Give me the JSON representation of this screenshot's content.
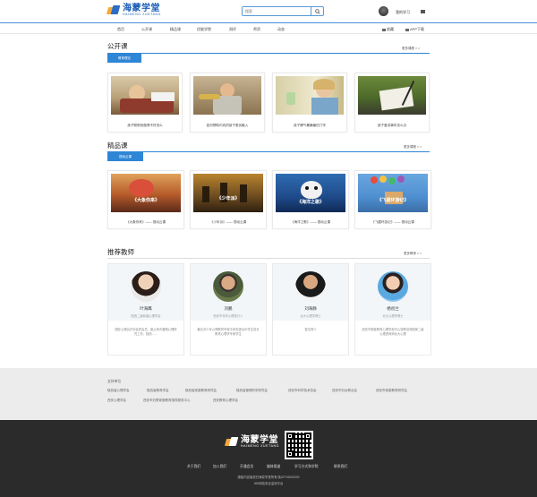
{
  "header": {
    "logo_cn": "海蒙学堂",
    "logo_en": "HAIMENG XUETANG",
    "search_placeholder": "搜索",
    "my_learning": "我的学习"
  },
  "nav": {
    "items": [
      "首页",
      "公开课",
      "精品课",
      "优能学院",
      "测评",
      "师资",
      "动态"
    ],
    "right": [
      "收藏",
      "APP下载"
    ]
  },
  "open_course": {
    "title": "公开课",
    "more": "更多课程 > >",
    "tab": "教育理论",
    "cards": [
      {
        "caption": "孩子聪明但做得不好怎么"
      },
      {
        "caption": "如何帮助内向的孩子更优融入"
      },
      {
        "caption": "孩子脾气暴躁最怕门牢"
      },
      {
        "caption": "孩子爱讲事件怎么办"
      }
    ]
  },
  "premium_course": {
    "title": "精品课",
    "more": "更多课程 > >",
    "tab": "视动云课",
    "cards": [
      {
        "banner": "《大象你来》",
        "caption": "《大象你来》—— 视动云课"
      },
      {
        "banner": "《少年派》",
        "caption": "《少年派》—— 视动云课"
      },
      {
        "banner": "《海洋之歌》",
        "caption": "《海洋之歌》—— 视动云课"
      },
      {
        "banner": "《飞屋环游记》",
        "caption": "《飞屋环游记》—— 视动云课"
      }
    ]
  },
  "teachers": {
    "title": "推荐教师",
    "more": "更多教师 > >",
    "list": [
      {
        "name": "叶海鹰",
        "role": "陕西二级和谐心理学会",
        "desc": "国际心理治疗协会的会员，曾从事青春期心理研究工作。陕西……"
      },
      {
        "name": "刘鹏",
        "role": "西安市青年心理执行人",
        "desc": "著名青少年心理教育专家中央电视台中学生成长教育心理学专家学生"
      },
      {
        "name": "刘海静",
        "role": "北大心理学博士",
        "desc": "暂无简介"
      },
      {
        "name": "杨创兰",
        "role": "北大心理学博士",
        "desc": "西安市家庭教育心理学部中心特聘讲师国家二级心理咨询师北大心理"
      }
    ]
  },
  "support": {
    "title": "支持单位",
    "row1": [
      "陕西省心理学会",
      "陕西省教育学会",
      "陕西省家庭教育研究会",
      "陕西省管理科学研究会",
      "西安市科学技术协会",
      "西安市妇女联合会",
      "西安市家庭教育研究会"
    ],
    "row2": [
      "西安心理学会",
      "西安市妇联家庭教育指导服务中心",
      "西安教育心理学会"
    ]
  },
  "footer": {
    "logo_cn": "海蒙学堂",
    "logo_en": "HAIMENG XUETANG",
    "links": [
      "关于我们",
      "加入我们",
      "开通会员",
      "媒体报道",
      "学习方式和学院",
      "联系我们"
    ],
    "copyright": "源链内容版权归海蒙学堂所有 陕ICP15000200",
    "police": "360网站安全监测平台"
  },
  "colors": {
    "primary": "#2f86d6",
    "brand": "#1c5fb8",
    "footer_bg": "#2b2b2b",
    "support_bg": "#ececec"
  }
}
